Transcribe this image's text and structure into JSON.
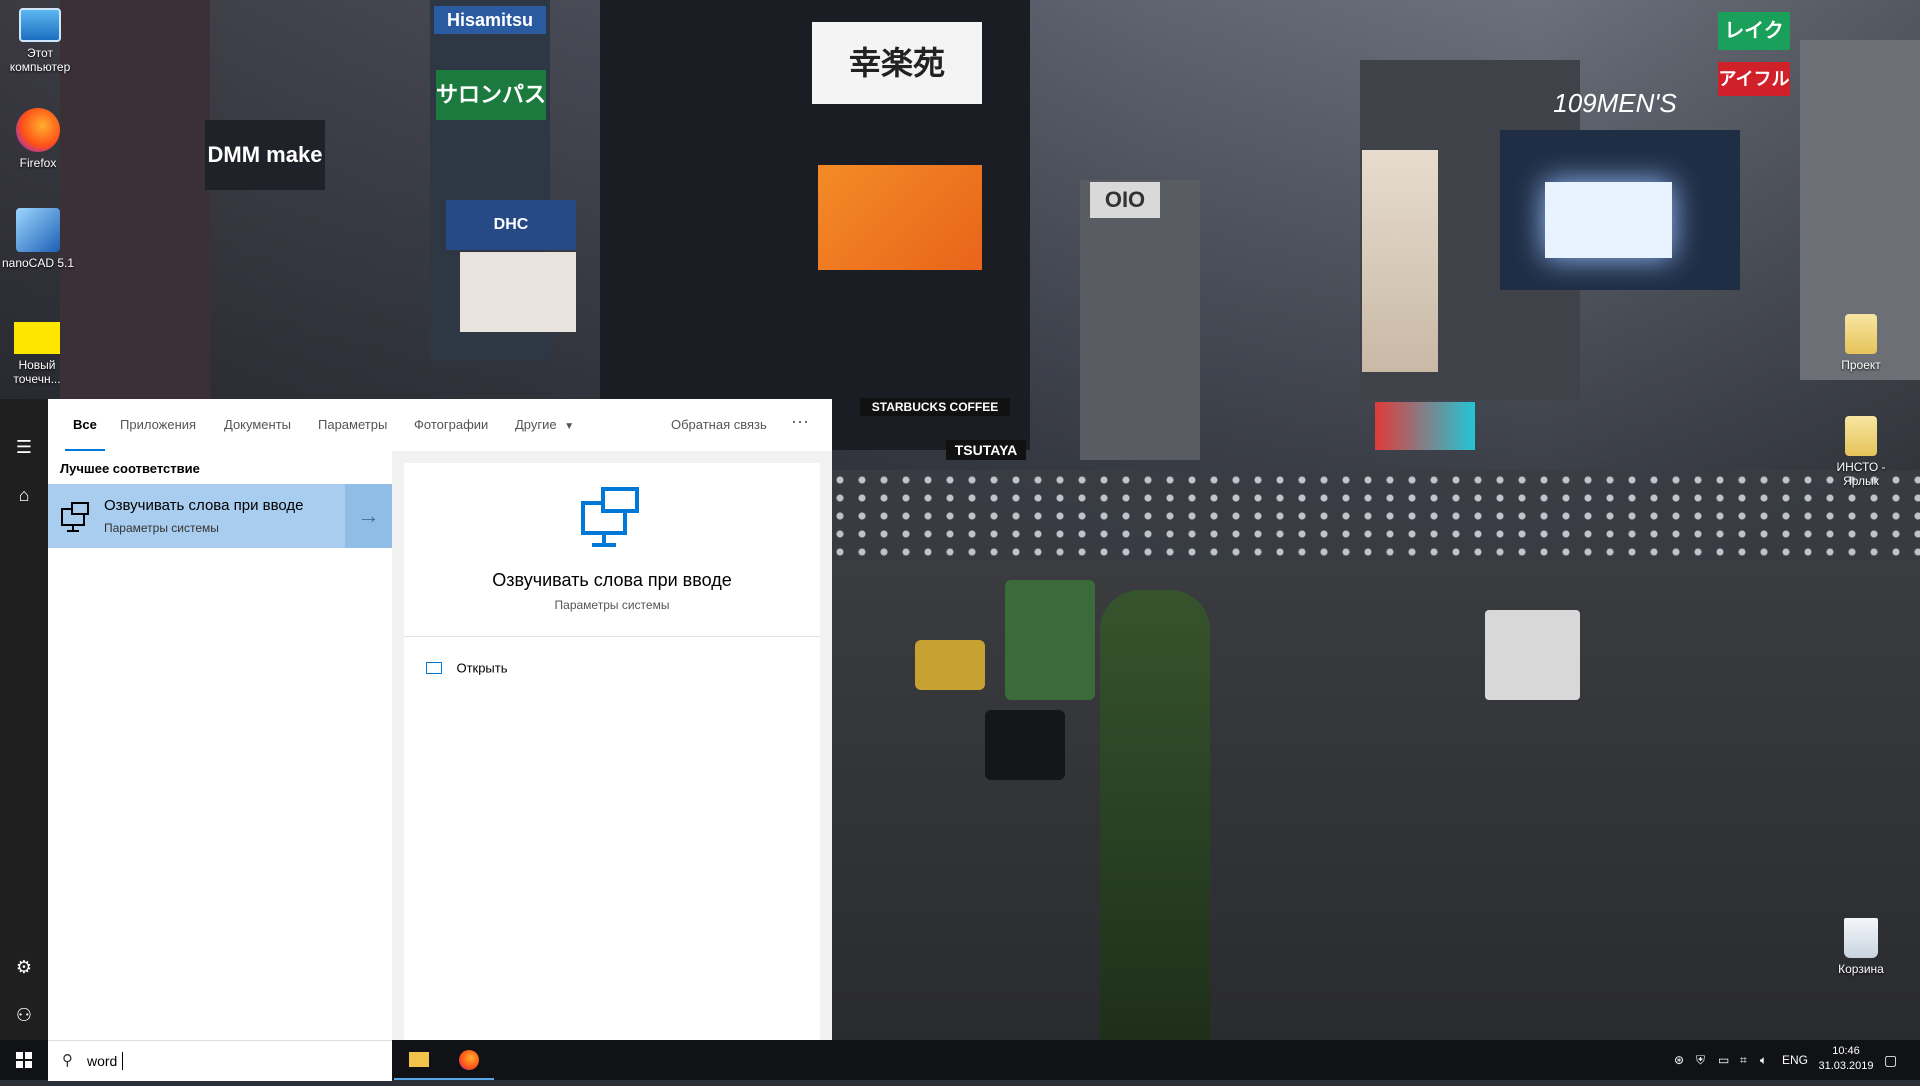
{
  "desktop": {
    "icons_left": [
      {
        "label": "Этот компьютер",
        "icon": "computer-icon"
      },
      {
        "label": "Firefox",
        "icon": "firefox-icon"
      },
      {
        "label": "nanoCAD 5.1",
        "icon": "nanocad-icon"
      },
      {
        "label": "Новый точечн...",
        "icon": "image-file-icon"
      }
    ],
    "icons_right": [
      {
        "label": "Проект",
        "icon": "folder-icon"
      },
      {
        "label": "ИНСТО - Ярлык",
        "icon": "folder-shortcut-icon"
      },
      {
        "label": "Корзина",
        "icon": "recycle-bin-icon"
      }
    ],
    "signs": {
      "hisamitsu": "Hisamitsu",
      "salonpas": "サロンパス",
      "dmm": "DMM make",
      "koraku": "幸楽苑",
      "men": "109MEN'S",
      "tsutaya": "TSUTAYA",
      "starbucks": "STARBUCKS COFFEE",
      "oio": "OIO",
      "reiku": "レイク",
      "aifuru": "アイフル",
      "dhc": "DHC"
    }
  },
  "search": {
    "tabs": [
      "Все",
      "Приложения",
      "Документы",
      "Параметры",
      "Фотографии",
      "Другие"
    ],
    "feedback": "Обратная связь",
    "more": "···",
    "best_match_header": "Лучшее соответствие",
    "result": {
      "title": "Озвучивать слова при вводе",
      "subtitle": "Параметры системы"
    },
    "detail": {
      "title": "Озвучивать слова при вводе",
      "subtitle": "Параметры системы",
      "open_label": "Открыть"
    },
    "query": "word"
  },
  "taskbar": {
    "language": "ENG",
    "time": "10:46",
    "date": "31.03.2019"
  },
  "colors": {
    "accent": "#0078d7",
    "selected_result": "#a8cdee"
  }
}
